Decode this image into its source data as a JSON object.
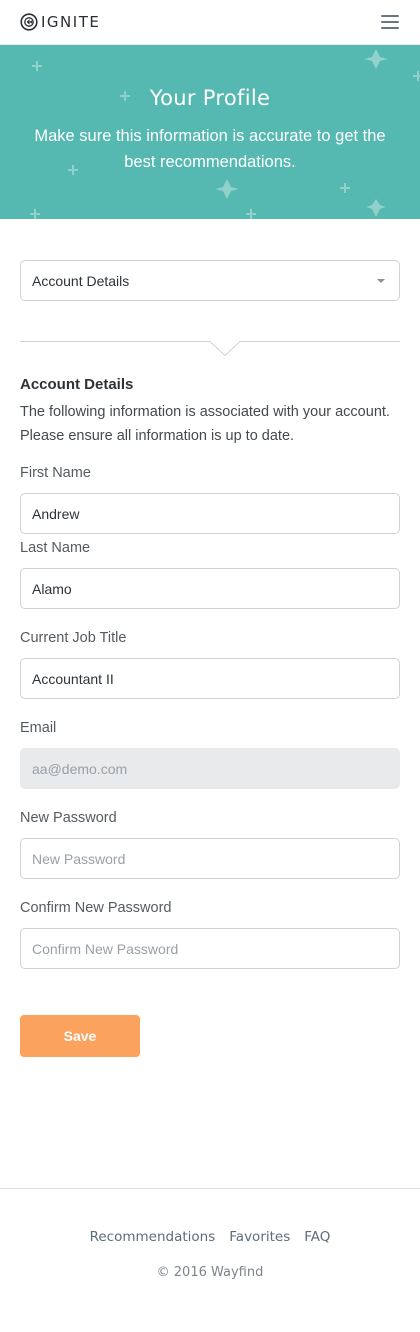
{
  "header": {
    "brand_name": "IGNITE",
    "logo_icon": "ignite-logo-icon",
    "menu_icon": "hamburger-menu-icon"
  },
  "hero": {
    "title": "Your Profile",
    "subtitle": "Make sure this information is accurate to get the best recommendations.",
    "background_color": "#55b8b1"
  },
  "section_select": {
    "selected": "Account Details",
    "icon": "chevron-down-icon"
  },
  "account": {
    "heading": "Account Details",
    "description": "The following information is associated with your account. Please ensure all information is up to date."
  },
  "form": {
    "first_name": {
      "label": "First Name",
      "value": "Andrew"
    },
    "last_name": {
      "label": "Last Name",
      "value": "Alamo"
    },
    "job_title": {
      "label": "Current Job Title",
      "value": "Accountant II"
    },
    "email": {
      "label": "Email",
      "placeholder": "aa@demo.com",
      "disabled": true
    },
    "new_password": {
      "label": "New Password",
      "placeholder": "New Password",
      "value": ""
    },
    "confirm_password": {
      "label": "Confirm New Password",
      "placeholder": "Confirm New Password",
      "value": ""
    },
    "save_label": "Save"
  },
  "footer": {
    "links": [
      "Recommendations",
      "Favorites",
      "FAQ"
    ],
    "copyright": "© 2016 Wayfind"
  },
  "colors": {
    "accent": "#55b8b1",
    "button": "#fba25f",
    "footer_link": "#5c6e7c"
  }
}
